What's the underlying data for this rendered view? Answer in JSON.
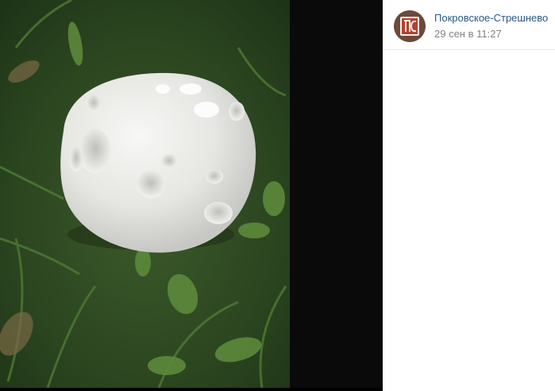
{
  "post": {
    "author": "Покровское-Стрешнево",
    "date": "29 сен в 11:27",
    "avatar_initials": "ПС",
    "avatar_color": "#6b4a3c",
    "link_color": "#2a5885"
  },
  "photo": {
    "subject": "white puffball mushroom on grass"
  }
}
